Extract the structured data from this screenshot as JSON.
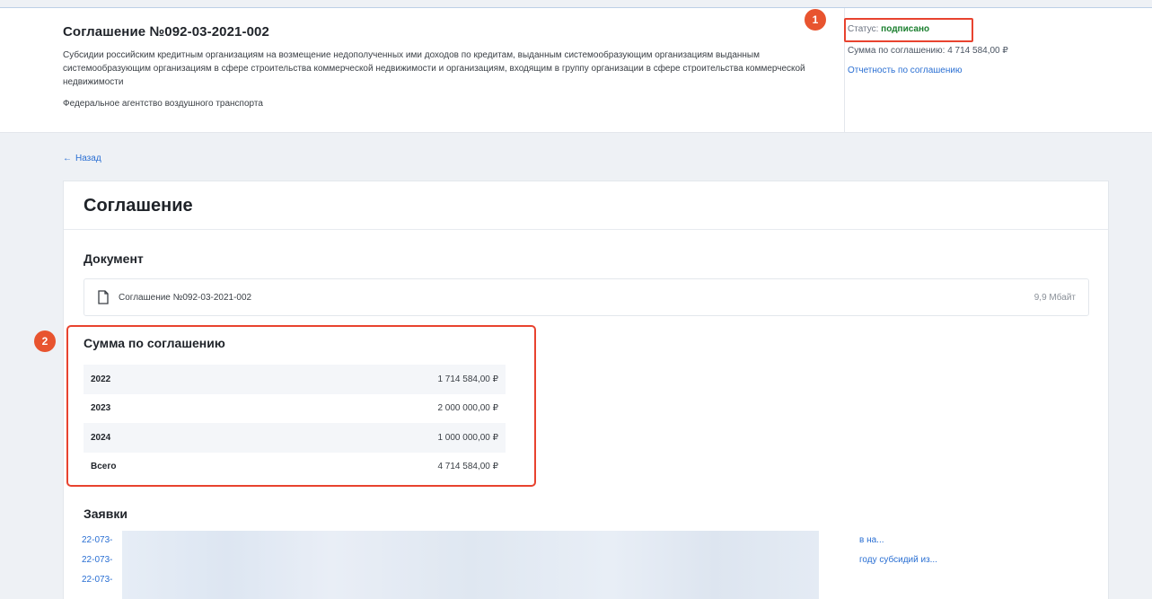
{
  "header": {
    "agreement_title": "Соглашение №092-03-2021-002",
    "description": "Субсидии российским кредитным организациям на возмещение недополученных ими доходов по кредитам, выданным системообразующим организациям выданным системообразующим организациям в сфере строительства коммерческой недвижимости и организациям, входящим в группу организации в сфере строительства коммерческой недвижимости",
    "agency": "Федеральное агентство воздушного транспорта",
    "status_label": "Статус:",
    "status_value": "подписано",
    "sum_line": "Сумма по соглашению: 4 714 584,00 ₽",
    "report_link": "Отчетность по соглашению",
    "status_color": "#1a7f2e"
  },
  "badges": {
    "one": "1",
    "two": "2"
  },
  "nav": {
    "back_label": "Назад"
  },
  "card": {
    "title": "Соглашение",
    "document_section": "Документ",
    "document": {
      "name": "Соглашение №092-03-2021-002",
      "size": "9,9 Мбайт"
    },
    "sum_section": "Сумма по соглашению",
    "sum_rows": [
      {
        "year": "2022",
        "amount": "1 714 584,00 ₽"
      },
      {
        "year": "2023",
        "amount": "2 000 000,00 ₽"
      },
      {
        "year": "2024",
        "amount": "1 000 000,00 ₽"
      },
      {
        "year": "Всего",
        "amount": "4 714 584,00 ₽"
      }
    ],
    "requests_section": "Заявки",
    "requests": [
      {
        "code": "22-073-",
        "tail": "в на..."
      },
      {
        "code": "22-073-",
        "tail": "году субсидий из..."
      },
      {
        "code": "22-073-",
        "tail": ""
      }
    ]
  },
  "colors": {
    "accent": "#2a6fd3",
    "highlight": "#e8432f",
    "badge": "#e8542f"
  }
}
